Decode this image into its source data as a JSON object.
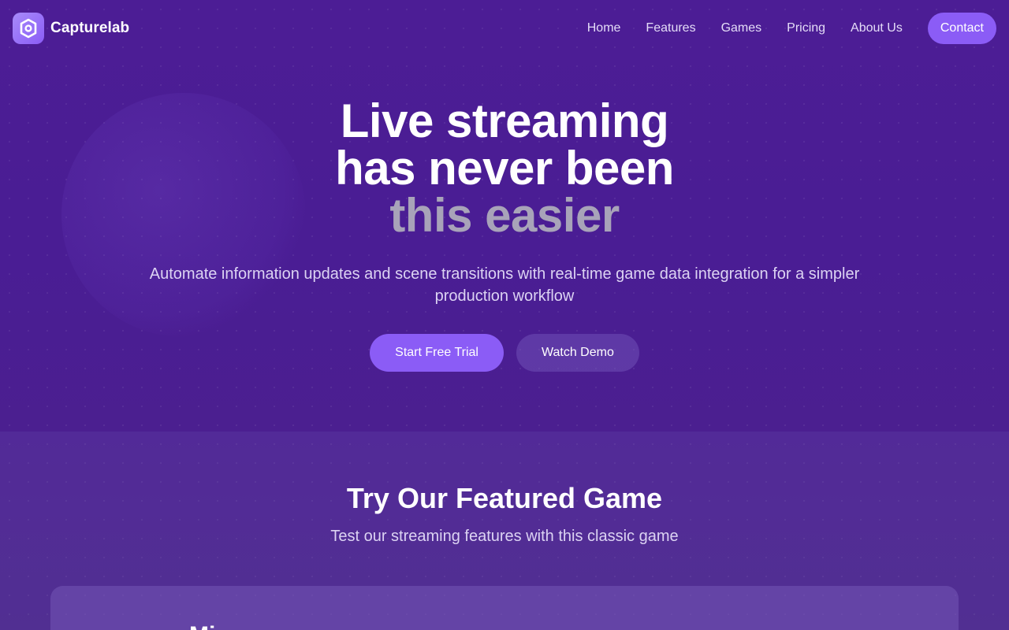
{
  "brand": {
    "name": "Capturelab",
    "logo_icon": "hexagon-logo-icon"
  },
  "nav": {
    "links": [
      "Home",
      "Features",
      "Games",
      "Pricing",
      "About Us"
    ],
    "contact_label": "Contact"
  },
  "hero": {
    "title_line1": "Live streaming",
    "title_line2": "has never been",
    "title_line3": "this easier",
    "subtitle": "Automate information updates and scene transitions with real-time game data integration for a simpler production workflow",
    "primary_cta": "Start Free Trial",
    "secondary_cta": "Watch Demo"
  },
  "featured": {
    "title": "Try Our Featured Game",
    "subtitle": "Test our streaming features with this classic game",
    "card_title": "Mi"
  },
  "colors": {
    "accent": "#8b5cf6",
    "background": "#4c1d95",
    "muted_title": "#a8a3b9"
  }
}
